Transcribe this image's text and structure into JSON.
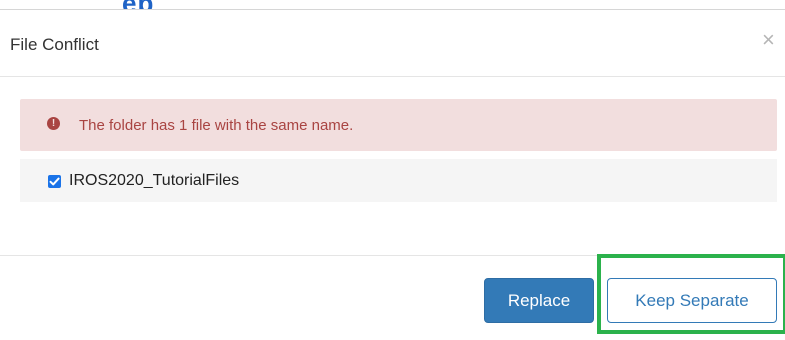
{
  "background": {
    "partial_heading": "ep"
  },
  "dialog": {
    "title": "File Conflict",
    "close_label": "×",
    "alert": {
      "icon": "exclamation-circle-icon",
      "message": "The folder has 1 file with the same name."
    },
    "files": [
      {
        "name": "IROS2020_TutorialFiles",
        "checked": true
      }
    ],
    "buttons": {
      "replace": "Replace",
      "keep_separate": "Keep Separate"
    }
  },
  "colors": {
    "primary": "#337ab7",
    "danger_text": "#a94442",
    "danger_bg": "#f2dede",
    "highlight": "#2bb24c",
    "checkbox": "#1a73e8"
  }
}
